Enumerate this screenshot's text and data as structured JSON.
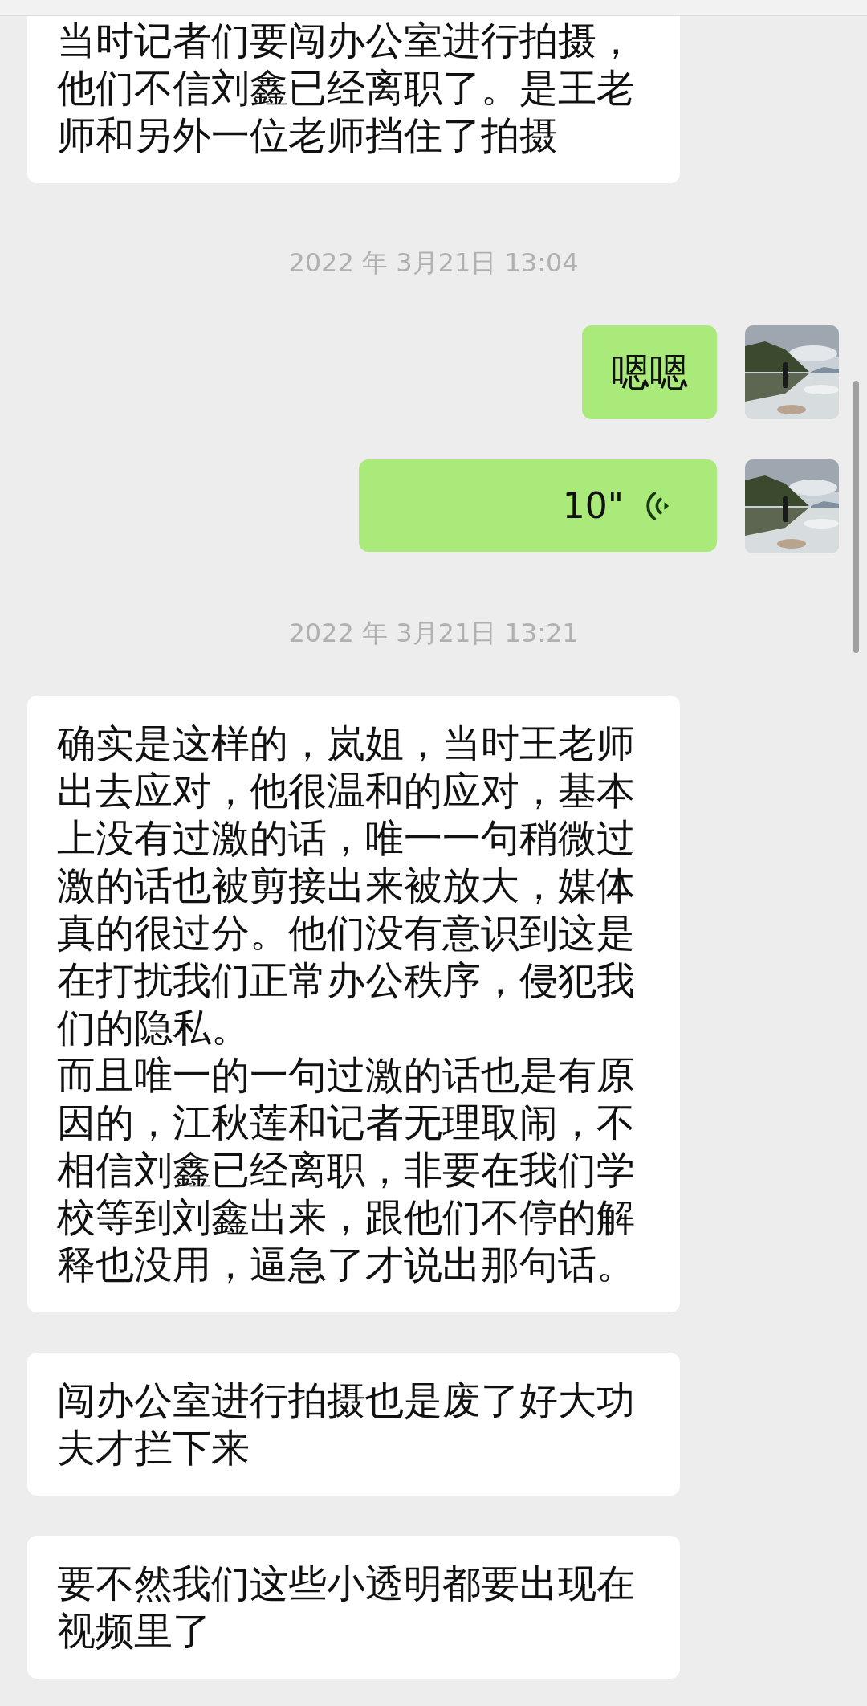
{
  "messages": [
    {
      "kind": "text",
      "outgoing": false,
      "paragraphs": [
        "当时记者们要闯办公室进行拍摄，他们不信刘鑫已经离职了。是王老师和另外一位老师挡住了拍摄"
      ]
    },
    {
      "kind": "time",
      "text": "2022 年 3月21日 13:04"
    },
    {
      "kind": "text",
      "outgoing": true,
      "paragraphs": [
        "嗯嗯"
      ]
    },
    {
      "kind": "voice",
      "outgoing": true,
      "duration": "10\""
    },
    {
      "kind": "time",
      "text": "2022 年 3月21日 13:21"
    },
    {
      "kind": "text",
      "outgoing": false,
      "paragraphs": [
        "确实是这样的，岚姐，当时王老师出去应对，他很温和的应对，基本上没有过激的话，唯一一句稍微过激的话也被剪接出来被放大，媒体真的很过分。他们没有意识到这是在打扰我们正常办公秩序，侵犯我们的隐私。",
        "而且唯一的一句过激的话也是有原因的，江秋莲和记者无理取闹，不相信刘鑫已经离职，非要在我们学校等到刘鑫出来，跟他们不停的解释也没用，逼急了才说出那句话。"
      ]
    },
    {
      "kind": "text",
      "outgoing": false,
      "paragraphs": [
        "闯办公室进行拍摄也是废了好大功夫才拦下来"
      ]
    },
    {
      "kind": "text",
      "outgoing": false,
      "paragraphs": [
        "要不然我们这些小透明都要出现在视频里了"
      ]
    }
  ]
}
